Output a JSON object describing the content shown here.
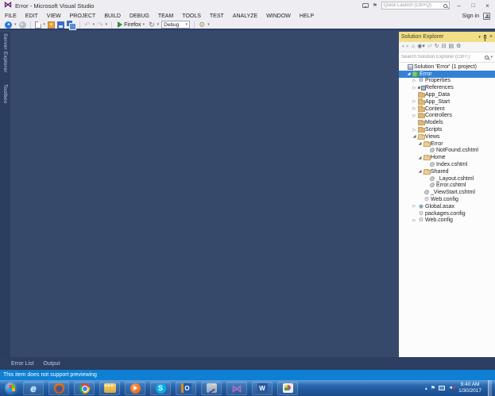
{
  "title_bar": {
    "app_title": "Error - Microsoft Visual Studio",
    "quick_launch_placeholder": "Quick Launch (Ctrl+Q)",
    "sign_in_label": "Sign in"
  },
  "menu_bar": {
    "items": [
      "FILE",
      "EDIT",
      "VIEW",
      "PROJECT",
      "BUILD",
      "DEBUG",
      "TEAM",
      "TOOLS",
      "TEST",
      "ANALYZE",
      "WINDOW",
      "HELP"
    ]
  },
  "toolbar": {
    "run_browser_label": "Firefox",
    "configuration_value": "Debug"
  },
  "side_dock_tabs": [
    {
      "label": "Server Explorer"
    },
    {
      "label": "Toolbox"
    }
  ],
  "solution_explorer": {
    "title": "Solution Explorer",
    "search_placeholder": "Search Solution Explorer (Ctrl+;)",
    "toolbar_icons": [
      "back",
      "forward",
      "home",
      "scope-view",
      "sync-with-active-document",
      "refresh",
      "collapse-all",
      "show-all-files",
      "properties"
    ],
    "tree": [
      {
        "label": "Solution 'Error' (1 project)",
        "level": 0,
        "arrow": "none",
        "icon": "solution-icon",
        "selected": false
      },
      {
        "label": "Error",
        "level": 1,
        "arrow": "expanded",
        "icon": "project-icon",
        "selected": true
      },
      {
        "label": "Properties",
        "level": 2,
        "arrow": "collapsed",
        "icon": "properties-icon",
        "selected": false
      },
      {
        "label": "References",
        "level": 2,
        "arrow": "collapsed",
        "icon": "references-icon",
        "selected": false
      },
      {
        "label": "App_Data",
        "level": 2,
        "arrow": "none",
        "icon": "folder-icon",
        "selected": false
      },
      {
        "label": "App_Start",
        "level": 2,
        "arrow": "collapsed",
        "icon": "folder-icon",
        "selected": false
      },
      {
        "label": "Content",
        "level": 2,
        "arrow": "collapsed",
        "icon": "folder-icon",
        "selected": false
      },
      {
        "label": "Controllers",
        "level": 2,
        "arrow": "collapsed",
        "icon": "folder-icon",
        "selected": false
      },
      {
        "label": "Models",
        "level": 2,
        "arrow": "none",
        "icon": "folder-icon",
        "selected": false
      },
      {
        "label": "Scripts",
        "level": 2,
        "arrow": "collapsed",
        "icon": "folder-icon",
        "selected": false
      },
      {
        "label": "Views",
        "level": 2,
        "arrow": "expanded",
        "icon": "folder-open-icon",
        "selected": false
      },
      {
        "label": "Error",
        "level": 3,
        "arrow": "expanded",
        "icon": "folder-open-icon",
        "selected": false
      },
      {
        "label": "NotFound.cshtml",
        "level": 4,
        "arrow": "none",
        "icon": "razor-icon",
        "selected": false
      },
      {
        "label": "Home",
        "level": 3,
        "arrow": "expanded",
        "icon": "folder-open-icon",
        "selected": false
      },
      {
        "label": "Index.cshtml",
        "level": 4,
        "arrow": "none",
        "icon": "razor-icon",
        "selected": false
      },
      {
        "label": "Shared",
        "level": 3,
        "arrow": "expanded",
        "icon": "folder-open-icon",
        "selected": false
      },
      {
        "label": "_Layout.cshtml",
        "level": 4,
        "arrow": "none",
        "icon": "razor-icon",
        "selected": false
      },
      {
        "label": "Error.cshtml",
        "level": 4,
        "arrow": "none",
        "icon": "razor-icon",
        "selected": false
      },
      {
        "label": "_ViewStart.cshtml",
        "level": 3,
        "arrow": "none",
        "icon": "razor-icon",
        "selected": false
      },
      {
        "label": "Web.config",
        "level": 3,
        "arrow": "none",
        "icon": "config-icon",
        "selected": false
      },
      {
        "label": "Global.asax",
        "level": 2,
        "arrow": "collapsed",
        "icon": "asax-icon",
        "selected": false
      },
      {
        "label": "packages.config",
        "level": 2,
        "arrow": "none",
        "icon": "config-icon",
        "selected": false
      },
      {
        "label": "Web.config",
        "level": 2,
        "arrow": "collapsed",
        "icon": "config-icon",
        "selected": false
      }
    ]
  },
  "bottom_panel": {
    "tabs": [
      {
        "label": "Error List"
      },
      {
        "label": "Output"
      }
    ]
  },
  "status_bar": {
    "message": "This item does not support previewing"
  },
  "taskbar": {
    "apps": [
      {
        "name": "internet-explorer-icon"
      },
      {
        "name": "firefox-icon"
      },
      {
        "name": "chrome-icon"
      },
      {
        "name": "movie-maker-icon"
      },
      {
        "name": "media-player-icon"
      },
      {
        "name": "skype-icon"
      },
      {
        "name": "outlook-icon"
      },
      {
        "name": "magic-wand-tool-icon"
      },
      {
        "name": "visual-studio-icon"
      },
      {
        "name": "word-icon"
      },
      {
        "name": "paint-icon"
      }
    ],
    "clock": {
      "time": "9:40 AM",
      "date": "1/30/2017"
    }
  },
  "colors": {
    "accent_blue": "#007ACC",
    "selection_blue": "#3380D6",
    "tool_header_gold": "#F2DE84",
    "status_blue": "#0E7FD2",
    "client_area": "#36496B"
  }
}
